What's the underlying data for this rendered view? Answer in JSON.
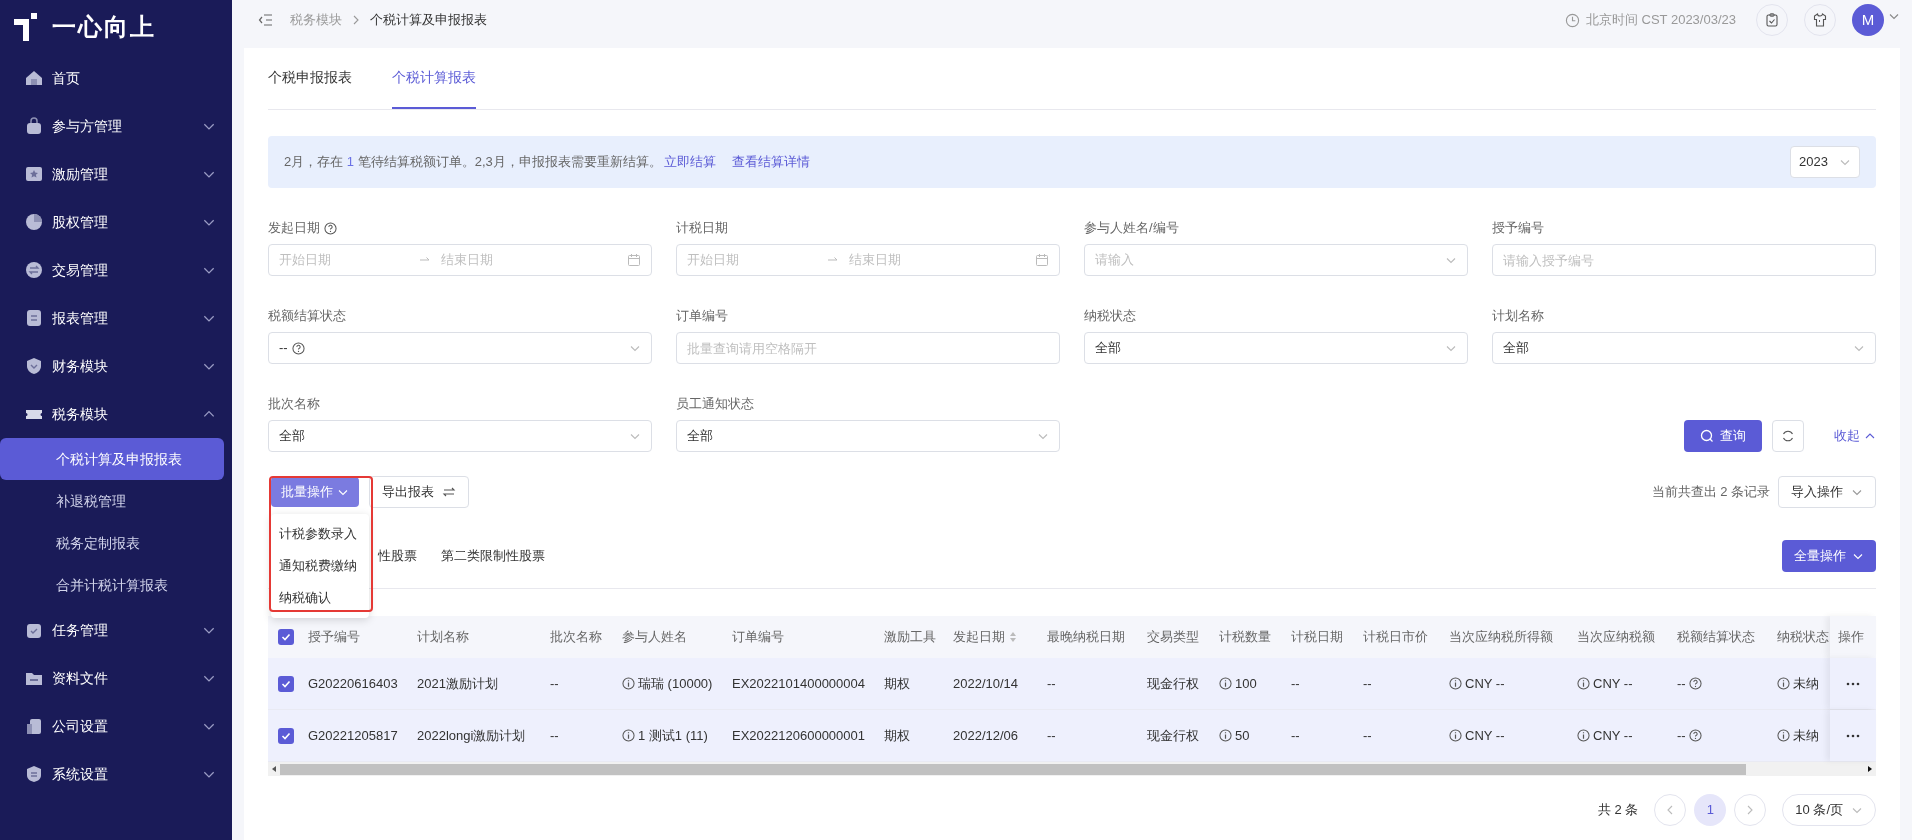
{
  "sidebar": {
    "logo": "一心向上",
    "items": [
      {
        "label": "首页"
      },
      {
        "label": "参与方管理",
        "expanded": false
      },
      {
        "label": "激励管理",
        "expanded": false
      },
      {
        "label": "股权管理",
        "expanded": false
      },
      {
        "label": "交易管理",
        "expanded": false
      },
      {
        "label": "报表管理",
        "expanded": false
      },
      {
        "label": "财务模块",
        "expanded": false
      },
      {
        "label": "税务模块",
        "expanded": true,
        "children": [
          {
            "label": "个税计算及申报报表",
            "selected": true
          },
          {
            "label": "补退税管理",
            "selected": false
          },
          {
            "label": "税务定制报表",
            "selected": false
          },
          {
            "label": "合并计税计算报表",
            "selected": false
          }
        ]
      },
      {
        "label": "任务管理",
        "expanded": false
      },
      {
        "label": "资料文件",
        "expanded": false
      },
      {
        "label": "公司设置",
        "expanded": false
      },
      {
        "label": "系统设置",
        "expanded": false
      }
    ]
  },
  "topbar": {
    "breadcrumb": [
      "税务模块",
      "个税计算及申报报表"
    ],
    "clock": "北京时间 CST 2023/03/23",
    "avatar": "M"
  },
  "tabs": [
    {
      "label": "个税申报报表",
      "selected": false
    },
    {
      "label": "个税计算报表",
      "selected": true
    }
  ],
  "alert": {
    "message": [
      {
        "kind": "plain",
        "text": "2月，存在 "
      },
      {
        "kind": "count",
        "text": "1"
      },
      {
        "kind": "plain",
        "text": " 笔待结算税额订单。2,3月，申报报表需要重新结算。"
      }
    ],
    "links": [
      "立即结算",
      "查看结算详情"
    ],
    "year": "2023"
  },
  "filters": [
    {
      "label": "发起日期",
      "help": true,
      "kind": "daterange",
      "start_placeholder": "开始日期",
      "end_placeholder": "结束日期"
    },
    {
      "label": "计税日期",
      "help": false,
      "kind": "daterange",
      "start_placeholder": "开始日期",
      "end_placeholder": "结束日期"
    },
    {
      "label": "参与人姓名/编号",
      "help": false,
      "kind": "select",
      "placeholder": "请输入"
    },
    {
      "label": "授予编号",
      "help": false,
      "kind": "text",
      "placeholder": "请输入授予编号"
    },
    {
      "label": "税额结算状态",
      "help": false,
      "kind": "select",
      "value": "--",
      "value_help": true
    },
    {
      "label": "订单编号",
      "help": false,
      "kind": "text",
      "placeholder": "批量查询请用空格隔开"
    },
    {
      "label": "纳税状态",
      "help": false,
      "kind": "select",
      "value": "全部"
    },
    {
      "label": "计划名称",
      "help": false,
      "kind": "select",
      "value": "全部"
    },
    {
      "label": "批次名称",
      "help": false,
      "kind": "select",
      "value": "全部"
    },
    {
      "label": "员工通知状态",
      "help": false,
      "kind": "select",
      "value": "全部"
    }
  ],
  "filter_actions": {
    "search": "查询",
    "collapse": "收起"
  },
  "toolbar": {
    "batch": {
      "label": "批量操作",
      "expanded": true,
      "menu": [
        "计税参数录入",
        "通知税费缴纳",
        "纳税确认"
      ]
    },
    "export": "导出报表",
    "record_count": "当前共查出 2 条记录",
    "import": "导入操作"
  },
  "sub_tabs": [
    {
      "label": "性股票",
      "selected": false
    },
    {
      "label": "第二类限制性股票",
      "selected": false
    }
  ],
  "bulk_action": "全量操作",
  "table": {
    "all_checked": true,
    "columns": [
      {
        "label": "授予编号",
        "kind": "text",
        "sortable": false
      },
      {
        "label": "计划名称",
        "kind": "text",
        "sortable": false
      },
      {
        "label": "批次名称",
        "kind": "text",
        "sortable": false
      },
      {
        "label": "参与人姓名",
        "kind": "info",
        "sortable": false
      },
      {
        "label": "订单编号",
        "kind": "text",
        "sortable": false
      },
      {
        "label": "激励工具",
        "kind": "text",
        "sortable": false
      },
      {
        "label": "发起日期",
        "kind": "text",
        "sortable": true
      },
      {
        "label": "最晚纳税日期",
        "kind": "text",
        "sortable": false
      },
      {
        "label": "交易类型",
        "kind": "text",
        "sortable": false
      },
      {
        "label": "计税数量",
        "kind": "info",
        "sortable": false
      },
      {
        "label": "计税日期",
        "kind": "text",
        "sortable": false
      },
      {
        "label": "计税日市价",
        "kind": "text",
        "sortable": false
      },
      {
        "label": "当次应纳税所得额",
        "kind": "info",
        "sortable": false
      },
      {
        "label": "当次应纳税额",
        "kind": "info",
        "sortable": false
      },
      {
        "label": "税额结算状态",
        "kind": "help",
        "sortable": false
      },
      {
        "label": "纳税状态",
        "kind": "info",
        "sortable": false
      },
      {
        "label": "操作",
        "kind": "actions",
        "sortable": false
      }
    ],
    "rows": [
      {
        "selected": true,
        "cells": [
          "G20220616403",
          "2021激励计划",
          "--",
          "瑞瑞 (10000)",
          "EX2022101400000004",
          "期权",
          "2022/10/14",
          "--",
          "现金行权",
          "100",
          "--",
          "--",
          "CNY --",
          "CNY --",
          "--",
          "未纳"
        ]
      },
      {
        "selected": true,
        "cells": [
          "G20221205817",
          "2022longi激励计划",
          "--",
          "1 测试1 (11)",
          "EX2022120600000001",
          "期权",
          "2022/12/06",
          "--",
          "现金行权",
          "50",
          "--",
          "--",
          "CNY --",
          "CNY --",
          "--",
          "未纳"
        ]
      }
    ]
  },
  "pagination": {
    "total": "共 2 条",
    "pages": [
      {
        "label": "1",
        "selected": true
      }
    ],
    "page_size": "10 条/页"
  }
}
